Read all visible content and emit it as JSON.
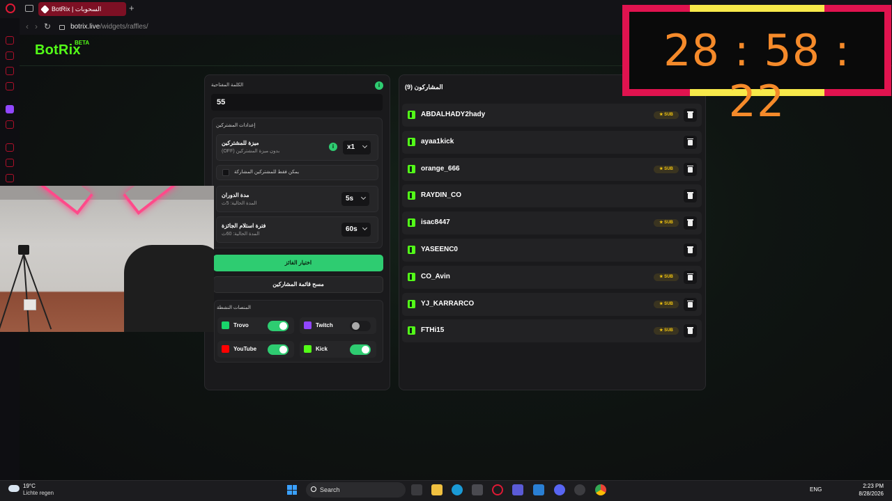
{
  "browser": {
    "tab_title": "BotRix | السحوبات",
    "new_tab": "+",
    "url_host": "botrix.live",
    "url_path": "/widgets/raffles/"
  },
  "app": {
    "logo": "BotRix",
    "beta": "BETA"
  },
  "settings": {
    "keyword_label": "الكلمة المفتاحية",
    "keyword_value": "55",
    "subscriber_settings_title": "إعدادات المشتركين",
    "sub_bonus": {
      "title": "ميزة للمشتركين",
      "subtitle": "بدون ميزة المشتركين (OFF)",
      "value": "x1"
    },
    "only_subs_label": "يمكن فقط للمشتركين المشاركة",
    "spin_duration": {
      "title": "مدة الدوران",
      "subtitle": "المدة الحالية: 5ث",
      "value": "5s"
    },
    "claim_period": {
      "title": "فترة استلام الجائزة",
      "subtitle": "المدة الحالية: 60ث",
      "value": "60s"
    },
    "pick_winner_button": "اختيار الفائز",
    "clear_list_button": "مسح قائمة المشاركين",
    "platforms_title": "المنصات النشطة",
    "info_glyph": "i",
    "platforms": [
      {
        "name": "Trovo",
        "enabled": true,
        "color": "#19d66b"
      },
      {
        "name": "Twitch",
        "enabled": false,
        "color": "#9146ff"
      },
      {
        "name": "YouTube",
        "enabled": true,
        "color": "#ff0000"
      },
      {
        "name": "Kick",
        "enabled": true,
        "color": "#53fc18"
      }
    ]
  },
  "participants": {
    "title": "المشاركون (9)",
    "sub_badge": "★ SUB",
    "list": [
      {
        "name": "ABDALHADY2hady",
        "sub": true
      },
      {
        "name": "ayaa1kick",
        "sub": false
      },
      {
        "name": "orange_666",
        "sub": true
      },
      {
        "name": "RAYDIN_CO",
        "sub": false
      },
      {
        "name": "isac8447",
        "sub": true
      },
      {
        "name": "YASEENC0",
        "sub": false
      },
      {
        "name": "CO_Avin",
        "sub": true
      },
      {
        "name": "YJ_KARRARCO",
        "sub": true
      },
      {
        "name": "FTHi15",
        "sub": true
      }
    ]
  },
  "timer": {
    "display": "28 : 58 : 22"
  },
  "taskbar": {
    "weather_temp": "19°C",
    "weather_desc": "Lichte regen",
    "search_placeholder": "Search",
    "language": "ENG",
    "time": "2:23 PM",
    "date": "8/28/2026"
  },
  "colors": {
    "brand_green": "#53fc18",
    "accent_green": "#2ecc71",
    "timer_frame": "#e0134f",
    "timer_digits": "#f58a2a"
  }
}
